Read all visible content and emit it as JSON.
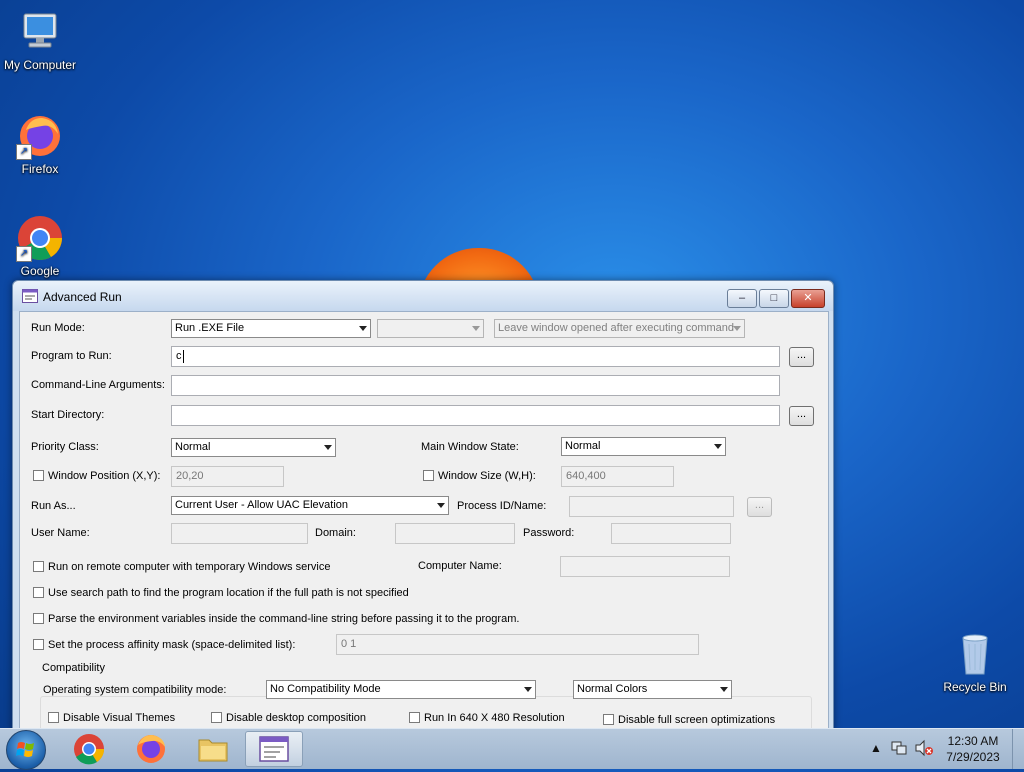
{
  "desktop": {
    "icons": [
      {
        "label": "My Computer"
      },
      {
        "label": "Firefox"
      },
      {
        "label": "Google"
      },
      {
        "label": "Recycle Bin"
      }
    ]
  },
  "window": {
    "title": "Advanced Run",
    "minimize": "–",
    "maximize": "□",
    "close": "✕",
    "run_mode": {
      "label": "Run Mode:",
      "value": "Run .EXE File",
      "secondary_value": "",
      "after_exec_value": "Leave window opened after executing command"
    },
    "program": {
      "label": "Program to Run:",
      "value": "c",
      "browse": "..."
    },
    "args": {
      "label": "Command-Line Arguments:",
      "value": ""
    },
    "start_dir": {
      "label": "Start Directory:",
      "value": "",
      "browse": "..."
    },
    "priority": {
      "label": "Priority Class:",
      "value": "Normal"
    },
    "main_window_state": {
      "label": "Main Window State:",
      "value": "Normal"
    },
    "window_position": {
      "label": "Window Position (X,Y):",
      "value": "20,20"
    },
    "window_size": {
      "label": "Window Size (W,H):",
      "value": "640,400"
    },
    "run_as": {
      "label": "Run As...",
      "value": "Current User - Allow UAC Elevation"
    },
    "process_id": {
      "label": "Process ID/Name:",
      "value": "",
      "browse": "..."
    },
    "user_name": {
      "label": "User Name:",
      "value": ""
    },
    "domain": {
      "label": "Domain:",
      "value": ""
    },
    "password": {
      "label": "Password:",
      "value": ""
    },
    "remote": {
      "label": "Run on remote computer with temporary Windows service",
      "checked": false
    },
    "computer_name": {
      "label": "Computer Name:",
      "value": ""
    },
    "search_path": {
      "label": "Use search path to find the program location if the full path is not specified",
      "checked": false
    },
    "parse_env": {
      "label": "Parse the environment variables inside the command-line string before passing it to the program.",
      "checked": false
    },
    "affinity": {
      "label": "Set the process affinity mask (space-delimited list):",
      "value": "0 1",
      "checked": false
    },
    "compat": {
      "group_label": "Compatibility",
      "os_mode_label": "Operating system compatibility mode:",
      "os_mode_value": "No Compatibility Mode",
      "colors_value": "Normal Colors",
      "disable_themes": "Disable Visual Themes",
      "disable_composition": "Disable desktop composition",
      "run_640": "Run In 640 X 480 Resolution",
      "disable_fullscreen": "Disable full screen optimizations"
    }
  },
  "taskbar": {
    "time": "12:30 AM",
    "date": "7/29/2023"
  },
  "colors": {
    "desktop_blue": "#1a66c9",
    "title_gradient_top": "#eaf2fb",
    "close_red": "#c7412b"
  }
}
